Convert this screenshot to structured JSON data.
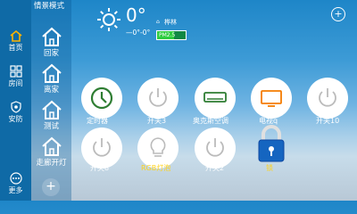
{
  "nav": {
    "items": [
      {
        "label": "首页",
        "icon": "home-icon"
      },
      {
        "label": "房间",
        "icon": "rooms-grid-icon"
      },
      {
        "label": "安防",
        "icon": "shield-icon"
      },
      {
        "label": "更多",
        "icon": "more-icon"
      }
    ]
  },
  "scenes": {
    "title": "情景模式",
    "items": [
      {
        "label": "回家",
        "icon": "house-icon"
      },
      {
        "label": "离家",
        "icon": "house-icon"
      },
      {
        "label": "测试",
        "icon": "house-icon"
      },
      {
        "label": "走廊开灯",
        "icon": "house-icon"
      }
    ],
    "add_label": "+"
  },
  "weather": {
    "icon": "sun-icon",
    "temperature": "0°",
    "range": "—0°-0°",
    "location": "桦林",
    "aqi_text": "PM2.5",
    "aqi_fraction": 0.6
  },
  "header": {
    "add_label": "+"
  },
  "devices": [
    {
      "label": "定时器",
      "icon": "clock-icon",
      "color": "#2e7d32"
    },
    {
      "label": "开关3",
      "icon": "power-icon"
    },
    {
      "label": "奥克斯空调",
      "icon": "air-conditioner-icon"
    },
    {
      "label": "电视q",
      "icon": "tv-icon",
      "color": "#f57c00"
    },
    {
      "label": "开关10",
      "icon": "power-icon"
    },
    {
      "label": "开关8",
      "icon": "power-icon"
    },
    {
      "label": "RGB灯泡",
      "icon": "bulb-icon",
      "label_color": "#ffd21a"
    },
    {
      "label": "开关2",
      "icon": "power-icon"
    },
    {
      "label": "锁",
      "icon": "lock-icon",
      "label_color": "#ffd21a",
      "color": "#1565c0"
    }
  ]
}
